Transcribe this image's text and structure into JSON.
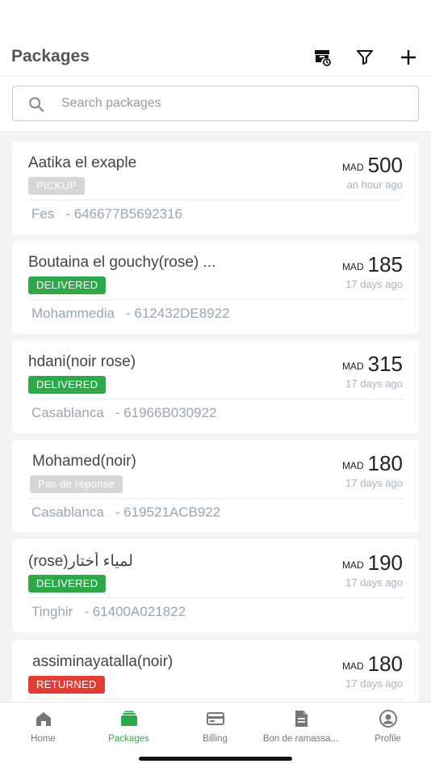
{
  "header": {
    "title": "Packages"
  },
  "search": {
    "placeholder": "Search packages",
    "value": ""
  },
  "packages": [
    {
      "name": "Aatika el exaple",
      "status": "PICKUP",
      "status_color": "#d6d6d6",
      "city": "Fes",
      "code": "- 646677B5692316",
      "currency": "MAD",
      "amount": "500",
      "time": "an hour ago"
    },
    {
      "name": "Boutaina el gouchy(rose)  ...",
      "status": "DELIVERED",
      "status_color": "#2ea84a",
      "city": "Mohammedia",
      "code": "- 612432DE8922",
      "currency": "MAD",
      "amount": "185",
      "time": "17 days ago"
    },
    {
      "name": "hdani(noir rose)",
      "status": "DELIVERED",
      "status_color": "#2ea84a",
      "city": "Casablanca",
      "code": "- 61966B030922",
      "currency": "MAD",
      "amount": "315",
      "time": "17 days ago"
    },
    {
      "name": "Mohamed(noir)",
      "status": "Pas de réponse",
      "status_color": "#d6d6d6",
      "city": "Casablanca",
      "code": "- 619521ACB922",
      "currency": "MAD",
      "amount": "180",
      "time": "17 days ago"
    },
    {
      "name": "(rose)لمياء أختار",
      "status": "DELIVERED",
      "status_color": "#2ea84a",
      "city": "Tinghir",
      "code": "- 61400A021822",
      "currency": "MAD",
      "amount": "190",
      "time": "17 days ago"
    },
    {
      "name": "assiminayatalla(noir)",
      "status": "RETURNED",
      "status_color": "#e53b35",
      "city": "",
      "code": "",
      "currency": "MAD",
      "amount": "180",
      "time": "17 days ago"
    }
  ],
  "tabs": [
    {
      "label": "Home",
      "icon": "home-icon",
      "active": false
    },
    {
      "label": "Packages",
      "icon": "packages-icon",
      "active": true
    },
    {
      "label": "Billing",
      "icon": "credit-card-icon",
      "active": false
    },
    {
      "label": "Bon de ramassa...",
      "icon": "document-icon",
      "active": false
    },
    {
      "label": "Profile",
      "icon": "profile-icon",
      "active": false
    }
  ],
  "colors": {
    "accent": "#2ea84a",
    "returned": "#e53b35",
    "muted": "#9aa5b4"
  }
}
